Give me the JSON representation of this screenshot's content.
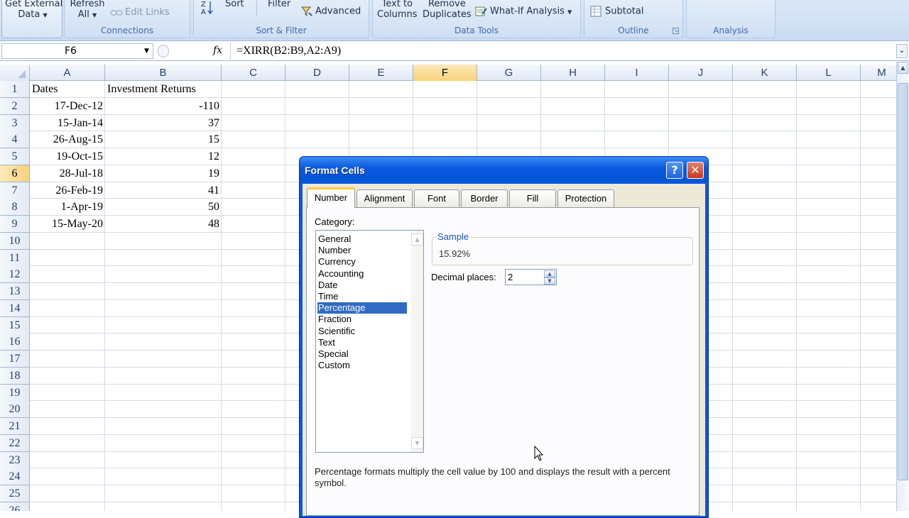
{
  "ribbon": {
    "get_external_data": [
      "Get External",
      "Data"
    ],
    "refresh_all": [
      "Refresh",
      "All"
    ],
    "edit_links": "Edit Links",
    "sort": "Sort",
    "filter": "Filter",
    "advanced": "Advanced",
    "text_to_columns": [
      "Text to",
      "Columns"
    ],
    "remove_duplicates": [
      "Remove",
      "Duplicates"
    ],
    "what_if": "What-If Analysis",
    "subtotal": "Subtotal",
    "groups": {
      "connections": "Connections",
      "sort_filter": "Sort & Filter",
      "data_tools": "Data Tools",
      "outline": "Outline",
      "analysis": "Analysis"
    }
  },
  "formula_bar": {
    "name_box": "F6",
    "fx": "fx",
    "formula": "=XIRR(B2:B9,A2:A9)"
  },
  "sheet": {
    "columns": [
      "A",
      "B",
      "C",
      "D",
      "E",
      "F",
      "G",
      "H",
      "I",
      "J",
      "K",
      "L",
      "M"
    ],
    "selected_column": "F",
    "rows": [
      "1",
      "2",
      "3",
      "4",
      "5",
      "6",
      "7",
      "8",
      "9",
      "10",
      "11",
      "12",
      "13",
      "14",
      "15",
      "16",
      "17",
      "18",
      "19",
      "20",
      "21",
      "22",
      "23",
      "24",
      "25",
      "26"
    ],
    "selected_row": "6",
    "cells": {
      "header_a": "Dates",
      "header_b": "Investment Returns",
      "dates": [
        "17-Dec-12",
        "15-Jan-14",
        "26-Aug-15",
        "19-Oct-15",
        "28-Jul-18",
        "26-Feb-19",
        "1-Apr-19",
        "15-May-20"
      ],
      "returns": [
        "-110",
        "37",
        "15",
        "12",
        "19",
        "41",
        "50",
        "48"
      ]
    }
  },
  "dialog": {
    "title": "Format Cells",
    "help": "?",
    "close": "✕",
    "tabs": [
      "Number",
      "Alignment",
      "Font",
      "Border",
      "Fill",
      "Protection"
    ],
    "active_tab": "Number",
    "category_label": "Category:",
    "categories": [
      "General",
      "Number",
      "Currency",
      "Accounting",
      "Date",
      "Time",
      "Percentage",
      "Fraction",
      "Scientific",
      "Text",
      "Special",
      "Custom"
    ],
    "selected_category": "Percentage",
    "sample_label": "Sample",
    "sample_value": "15.92%",
    "decimal_label": "Decimal places:",
    "decimal_value": "2",
    "description": "Percentage formats multiply the cell value by 100 and displays the result with a percent symbol."
  },
  "icons": {
    "sort_az": "sort-az-icon",
    "filter": "filter-icon",
    "advanced": "advanced-filter-icon",
    "what_if": "what-if-icon",
    "subtotal": "subtotal-icon",
    "edit_links": "edit-links-icon"
  }
}
